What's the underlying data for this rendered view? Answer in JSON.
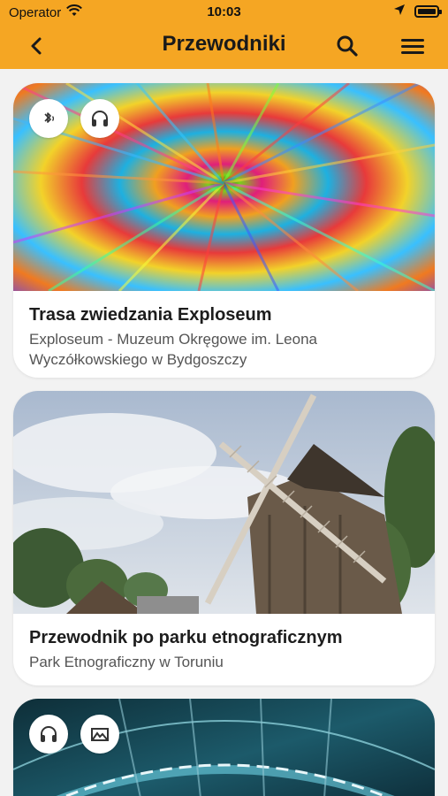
{
  "status": {
    "carrier": "Operator",
    "time": "10:03"
  },
  "nav": {
    "title": "Przewodniki",
    "back_icon": "chevron-left-icon",
    "search_icon": "search-icon",
    "menu_icon": "hamburger-menu-icon"
  },
  "colors": {
    "accent": "#f5a623",
    "background": "#f2f2f2",
    "card": "#ffffff"
  },
  "cards": [
    {
      "title": "Trasa zwiedzania Exploseum",
      "subtitle": "Exploseum - Muzeum Okręgowe im. Leona Wyczółkowskiego w Bydgoszczy",
      "badges": [
        "bluetooth-beacon-icon",
        "headphones-icon"
      ]
    },
    {
      "title": "Przewodnik po parku etnograficznym",
      "subtitle": "Park Etnograficzny w Toruniu",
      "badges": []
    },
    {
      "title": "",
      "subtitle": "",
      "badges": [
        "headphones-icon",
        "image-gallery-icon"
      ]
    }
  ]
}
